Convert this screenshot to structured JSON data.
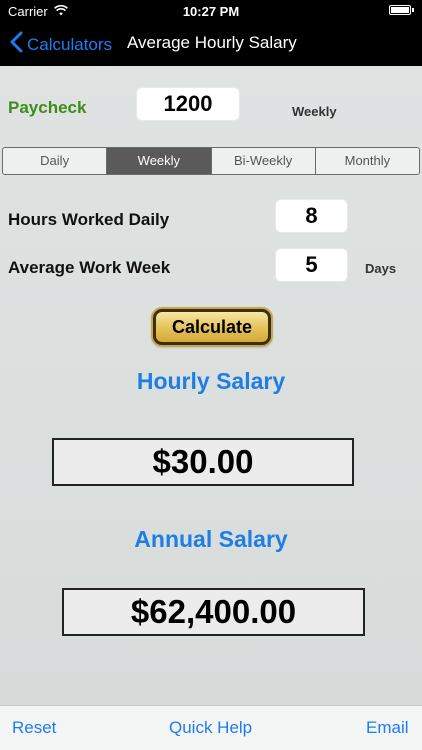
{
  "status_bar": {
    "carrier": "Carrier",
    "time": "10:27 PM",
    "battery_level": 1.0
  },
  "nav": {
    "back_label": "Calculators",
    "title": "Average Hourly Salary",
    "accent_color": "#1e7cf2"
  },
  "paycheck": {
    "label": "Paycheck",
    "value": "1200",
    "period_label": "Weekly"
  },
  "frequency_tabs": [
    {
      "label": "Daily",
      "selected": false
    },
    {
      "label": "Weekly",
      "selected": true
    },
    {
      "label": "Bi-Weekly",
      "selected": false
    },
    {
      "label": "Monthly",
      "selected": false
    }
  ],
  "hours": {
    "label": "Hours Worked Daily",
    "value": "8"
  },
  "work_week": {
    "label": "Average Work Week",
    "value": "5",
    "unit": "Days"
  },
  "calculate_label": "Calculate",
  "hourly": {
    "title": "Hourly Salary",
    "value": "$30.00"
  },
  "annual": {
    "title": "Annual Salary",
    "value": "$62,400.00"
  },
  "toolbar": {
    "reset_label": "Reset",
    "help_label": "Quick Help",
    "email_label": "Email"
  },
  "icons": {
    "wifi": "wifi-icon",
    "battery": "battery-icon",
    "back": "chevron-left-icon"
  }
}
